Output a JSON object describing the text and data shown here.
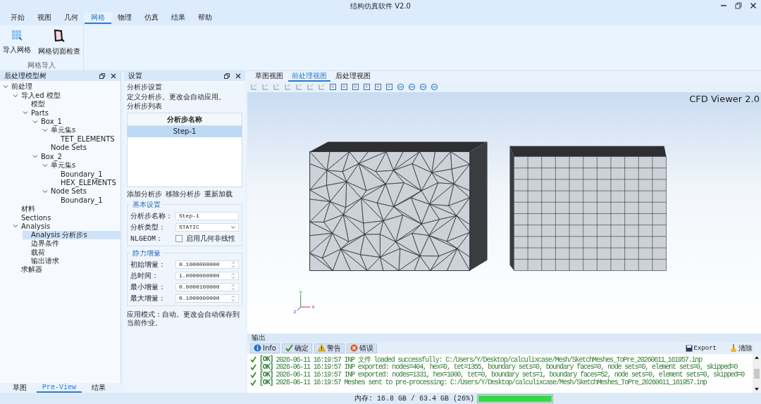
{
  "window": {
    "title": "结构仿真软件 V2.0"
  },
  "menu_tabs": [
    {
      "label": "开始",
      "selected": false
    },
    {
      "label": "视图",
      "selected": false
    },
    {
      "label": "几何",
      "selected": false
    },
    {
      "label": "网格",
      "selected": true
    },
    {
      "label": "物理",
      "selected": false
    },
    {
      "label": "仿真",
      "selected": false
    },
    {
      "label": "结果",
      "selected": false
    },
    {
      "label": "帮助",
      "selected": false
    }
  ],
  "ribbon": {
    "buttons": [
      {
        "label": "导入网格",
        "kind": "import"
      },
      {
        "label": "网格切面检查",
        "kind": "section"
      }
    ],
    "group_label": "网格导入"
  },
  "model_tree": {
    "title": "后处理模型树",
    "items": [
      {
        "label": "前处理",
        "expanded": true,
        "selected": false,
        "children": [
          {
            "label": "导入ed 模型",
            "expanded": true,
            "selected": false,
            "children": [
              {
                "label": "模型",
                "selected": false
              },
              {
                "label": "Parts",
                "expanded": true,
                "selected": false,
                "children": [
                  {
                    "label": "Box_1",
                    "expanded": true,
                    "selected": false,
                    "children": [
                      {
                        "label": "单元集s",
                        "expanded": true,
                        "selected": false,
                        "children": [
                          {
                            "label": "TET_ELEMENTS",
                            "selected": false
                          }
                        ]
                      },
                      {
                        "label": "Node Sets",
                        "selected": false
                      }
                    ]
                  },
                  {
                    "label": "Box_2",
                    "expanded": true,
                    "selected": false,
                    "children": [
                      {
                        "label": "单元集s",
                        "expanded": true,
                        "selected": false,
                        "children": [
                          {
                            "label": "Boundary_1",
                            "selected": false
                          },
                          {
                            "label": "HEX_ELEMENTS",
                            "selected": false
                          }
                        ]
                      },
                      {
                        "label": "Node Sets",
                        "expanded": true,
                        "selected": false,
                        "children": [
                          {
                            "label": "Boundary_1",
                            "selected": false
                          }
                        ]
                      }
                    ]
                  }
                ]
              }
            ]
          },
          {
            "label": "材料",
            "selected": false
          },
          {
            "label": "Sections",
            "selected": false
          },
          {
            "label": "Analysis",
            "expanded": true,
            "selected": false,
            "children": [
              {
                "label": "Analysis 分析步s",
                "selected": true
              },
              {
                "label": "边界条件",
                "selected": false
              },
              {
                "label": "载荷",
                "selected": false
              },
              {
                "label": "输出请求",
                "selected": false
              }
            ]
          },
          {
            "label": "求解器",
            "selected": false
          }
        ]
      }
    ]
  },
  "bottom_tabs": [
    {
      "label": "草图",
      "selected": false
    },
    {
      "label": "Pre-View",
      "selected": true
    },
    {
      "label": "结果",
      "selected": false
    }
  ],
  "settings": {
    "title": "设置",
    "heading": "分析步设置",
    "description": "定义分析步。更改会自动应用。",
    "list_label": "分析步列表",
    "table": {
      "column": "分析步名称",
      "rows": [
        {
          "name": "Step-1",
          "selected": true
        }
      ]
    },
    "actions": [
      "添加分析步",
      "移除分析步",
      "重新加载"
    ],
    "basic": {
      "title": "基本设置",
      "name_label": "分析步名称：",
      "name_value": "Step-1",
      "type_label": "分析类型：",
      "type_value": "STATIC",
      "nlgeom_label": "NLGEOM：",
      "nlgeom_checkbox": {
        "label": "启用几何非线性",
        "checked": false
      }
    },
    "increments": {
      "title": "静力增量",
      "fields": [
        {
          "label": "初始增量：",
          "value": "0.1000000000"
        },
        {
          "label": "总时间：",
          "value": "1.0000000000"
        },
        {
          "label": "最小增量：",
          "value": "0.0000100000"
        },
        {
          "label": "最大增量：",
          "value": "0.1000000000"
        }
      ]
    },
    "note": "应用模式：自动。更改会自动保存到当前作业。"
  },
  "view_tabs": [
    {
      "label": "草图视图",
      "selected": false
    },
    {
      "label": "前处理视图",
      "selected": true
    },
    {
      "label": "后处理视图",
      "selected": false
    }
  ],
  "viewport": {
    "caption": "CFD Viewer 2.0",
    "axes": {
      "y": "y",
      "x": "x",
      "z": "z"
    }
  },
  "output": {
    "title": "输出",
    "filters": [
      {
        "label": "Info",
        "kind": "info"
      },
      {
        "label": "确定",
        "kind": "ok"
      },
      {
        "label": "警告",
        "kind": "warning"
      },
      {
        "label": "错误",
        "kind": "error"
      }
    ],
    "export_label": "Export",
    "clear_label": "清除",
    "log": [
      {
        "status": "[OK]",
        "text": "2026-06-11 16:19:57 INP 文件 loaded successfully: C:/Users/Y/Desktop/calculixcase/Mesh/SketchMeshes_ToPre_20260611_161957.inp"
      },
      {
        "status": "[OK]",
        "text": "2026-06-11 16:19:57 INP exported: nodes=404, hex=0, tet=1355, boundary sets=0, boundary faces=0, node sets=0, element sets=0, skipped=0"
      },
      {
        "status": "[OK]",
        "text": "2026-06-11 16:19:57 INP exported: nodes=1331, hex=1000, tet=0, boundary sets=1, boundary faces=52, node sets=0, element sets=0, skipped=0"
      },
      {
        "status": "[OK]",
        "text": "2026-06-11 16:19:57 Meshes sent to pre-processing: C:/Users/Y/Desktop/calculixcase/Mesh/SketchMeshes_ToPre_20260611_161957.inp"
      }
    ]
  },
  "status_bar": {
    "memory": "内存: 16.8 GB / 63.4 GB (26%)",
    "level": 1
  }
}
